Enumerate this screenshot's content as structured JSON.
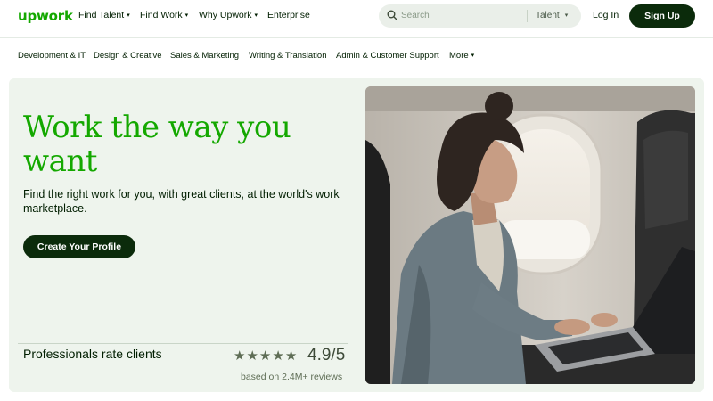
{
  "header": {
    "logo": "upwork",
    "nav": [
      {
        "label": "Find Talent",
        "dropdown": true
      },
      {
        "label": "Find Work",
        "dropdown": true
      },
      {
        "label": "Why Upwork",
        "dropdown": true
      },
      {
        "label": "Enterprise",
        "dropdown": false
      }
    ],
    "search": {
      "placeholder": "Search",
      "scope": "Talent"
    },
    "login": "Log In",
    "signup": "Sign Up"
  },
  "categories": [
    "Development & IT",
    "Design & Creative",
    "Sales & Marketing",
    "Writing & Translation",
    "Admin & Customer Support",
    "More"
  ],
  "hero": {
    "title": "Work the way you want",
    "subtitle": "Find the right work for you, with great clients, at the world's work marketplace.",
    "cta": "Create Your Profile",
    "rating_label": "Professionals rate clients",
    "stars": 5,
    "rating": "4.9/5",
    "reviews": "based on 2.4M+ reviews"
  },
  "colors": {
    "brand_green": "#14a800",
    "dark_button": "#0b2b0b",
    "hero_bg": "#eef4ed",
    "search_bg": "#eaefe9"
  }
}
